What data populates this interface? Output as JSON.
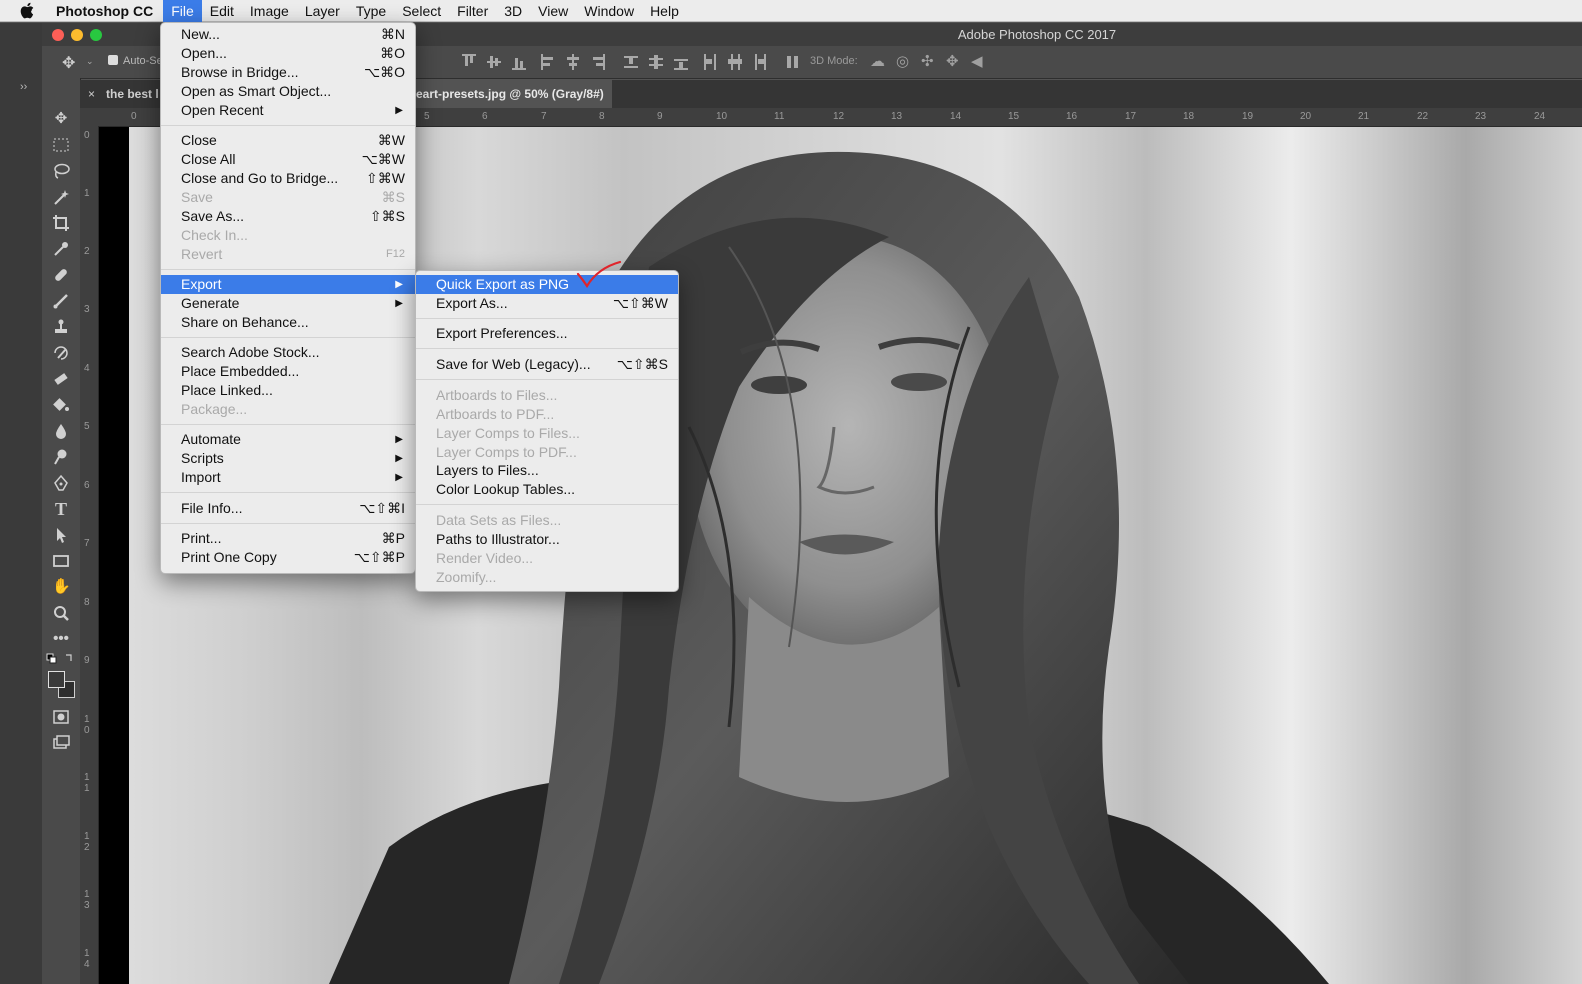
{
  "menubar": {
    "app_name": "Photoshop CC",
    "items": [
      "File",
      "Edit",
      "Image",
      "Layer",
      "Type",
      "Select",
      "Filter",
      "3D",
      "View",
      "Window",
      "Help"
    ]
  },
  "window": {
    "title": "Adobe Photoshop CC 2017"
  },
  "options_bar": {
    "auto_select_label": "Auto-Se",
    "mode_3d_label": "3D Mode:"
  },
  "tabs": [
    {
      "label": "the best l",
      "close": "×"
    },
    {
      "label": "eart-presets.jpg @ 50% (Gray/8#)"
    }
  ],
  "panel_toggle": "››",
  "hruler": [
    "0",
    "5",
    "6",
    "7",
    "8",
    "9",
    "10",
    "11",
    "12",
    "13",
    "14",
    "15",
    "16",
    "17",
    "18",
    "19",
    "20",
    "21",
    "22",
    "23",
    "24"
  ],
  "vruler": [
    "0",
    "1",
    "2",
    "3",
    "4",
    "5",
    "6",
    "7",
    "8",
    "9",
    "1 0",
    "1 1",
    "1 2",
    "1 3",
    "1 4"
  ],
  "file_menu": {
    "items": [
      {
        "label": "New...",
        "shortcut": "⌘N"
      },
      {
        "label": "Open...",
        "shortcut": "⌘O"
      },
      {
        "label": "Browse in Bridge...",
        "shortcut": "⌥⌘O"
      },
      {
        "label": "Open as Smart Object...",
        "shortcut": ""
      },
      {
        "label": "Open Recent",
        "shortcut": "",
        "submenu": true
      },
      {
        "label": "Close",
        "shortcut": "⌘W"
      },
      {
        "label": "Close All",
        "shortcut": "⌥⌘W"
      },
      {
        "label": "Close and Go to Bridge...",
        "shortcut": "⇧⌘W"
      },
      {
        "label": "Save",
        "shortcut": "⌘S",
        "disabled": true
      },
      {
        "label": "Save As...",
        "shortcut": "⇧⌘S"
      },
      {
        "label": "Check In...",
        "shortcut": "",
        "disabled": true
      },
      {
        "label": "Revert",
        "shortcut": "F12",
        "disabled": true
      },
      {
        "label": "Export",
        "shortcut": "",
        "submenu": true,
        "highlighted": true
      },
      {
        "label": "Generate",
        "shortcut": "",
        "submenu": true
      },
      {
        "label": "Share on Behance...",
        "shortcut": ""
      },
      {
        "label": "Search Adobe Stock...",
        "shortcut": ""
      },
      {
        "label": "Place Embedded...",
        "shortcut": ""
      },
      {
        "label": "Place Linked...",
        "shortcut": ""
      },
      {
        "label": "Package...",
        "shortcut": "",
        "disabled": true
      },
      {
        "label": "Automate",
        "shortcut": "",
        "submenu": true
      },
      {
        "label": "Scripts",
        "shortcut": "",
        "submenu": true
      },
      {
        "label": "Import",
        "shortcut": "",
        "submenu": true
      },
      {
        "label": "File Info...",
        "shortcut": "⌥⇧⌘I"
      },
      {
        "label": "Print...",
        "shortcut": "⌘P"
      },
      {
        "label": "Print One Copy",
        "shortcut": "⌥⇧⌘P"
      }
    ]
  },
  "export_menu": {
    "items": [
      {
        "label": "Quick Export as PNG",
        "shortcut": "",
        "highlighted": true
      },
      {
        "label": "Export As...",
        "shortcut": "⌥⇧⌘W"
      },
      {
        "label": "Export Preferences...",
        "shortcut": ""
      },
      {
        "label": "Save for Web (Legacy)...",
        "shortcut": "⌥⇧⌘S"
      },
      {
        "label": "Artboards to Files...",
        "shortcut": "",
        "disabled": true
      },
      {
        "label": "Artboards to PDF...",
        "shortcut": "",
        "disabled": true
      },
      {
        "label": "Layer Comps to Files...",
        "shortcut": "",
        "disabled": true
      },
      {
        "label": "Layer Comps to PDF...",
        "shortcut": "",
        "disabled": true
      },
      {
        "label": "Layers to Files...",
        "shortcut": ""
      },
      {
        "label": "Color Lookup Tables...",
        "shortcut": ""
      },
      {
        "label": "Data Sets as Files...",
        "shortcut": "",
        "disabled": true
      },
      {
        "label": "Paths to Illustrator...",
        "shortcut": ""
      },
      {
        "label": "Render Video...",
        "shortcut": "",
        "disabled": true
      },
      {
        "label": "Zoomify...",
        "shortcut": "",
        "disabled": true
      }
    ]
  },
  "colors": {
    "highlight": "#3b7ce8",
    "checkmark": "#e0242b",
    "disabled_text": "#a9a9a9"
  }
}
